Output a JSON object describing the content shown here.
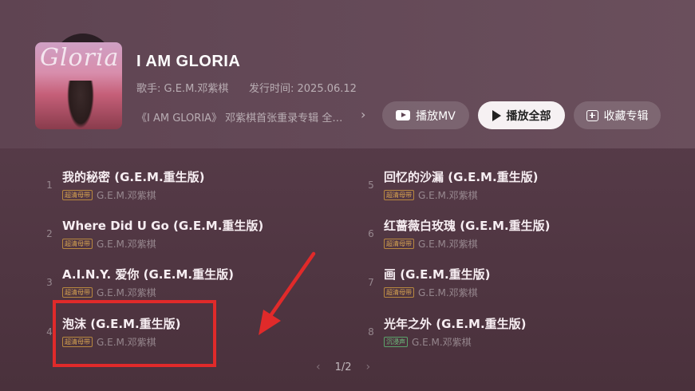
{
  "album": {
    "title": "I AM GLORIA",
    "cover_text": "Gloria",
    "artist_line": "歌手: G.E.M.邓紫棋",
    "release_line": "发行时间: 2025.06.12",
    "description": "《I AM GLORIA》 邓紫棋首张重录专辑 全新…"
  },
  "actions": {
    "play_mv": "播放MV",
    "play_all": "播放全部",
    "collect": "收藏专辑"
  },
  "songs": [
    {
      "num": "1",
      "title": "我的秘密 (G.E.M.重生版)",
      "badge": "超清母带",
      "artist": "G.E.M.邓紫棋"
    },
    {
      "num": "2",
      "title": "Where Did U Go (G.E.M.重生版)",
      "badge": "超清母带",
      "artist": "G.E.M.邓紫棋"
    },
    {
      "num": "3",
      "title": "A.I.N.Y. 爱你 (G.E.M.重生版)",
      "badge": "超清母带",
      "artist": "G.E.M.邓紫棋"
    },
    {
      "num": "4",
      "title": "泡沫 (G.E.M.重生版)",
      "badge": "超清母带",
      "artist": "G.E.M.邓紫棋"
    },
    {
      "num": "5",
      "title": "回忆的沙漏 (G.E.M.重生版)",
      "badge": "超清母带",
      "artist": "G.E.M.邓紫棋"
    },
    {
      "num": "6",
      "title": "红蔷薇白玫瑰 (G.E.M.重生版)",
      "badge": "超清母带",
      "artist": "G.E.M.邓紫棋"
    },
    {
      "num": "7",
      "title": "画 (G.E.M.重生版)",
      "badge": "超清母带",
      "artist": "G.E.M.邓紫棋"
    },
    {
      "num": "8",
      "title": "光年之外 (G.E.M.重生版)",
      "badge": "沉浸声",
      "artist": "G.E.M.邓紫棋"
    }
  ],
  "pager": {
    "prev": "‹",
    "label": "1/2",
    "next": "›"
  },
  "colors": {
    "annotation": "#e02a2a",
    "badge_gold": "#d8a451",
    "badge_green": "#6fbf7f"
  }
}
